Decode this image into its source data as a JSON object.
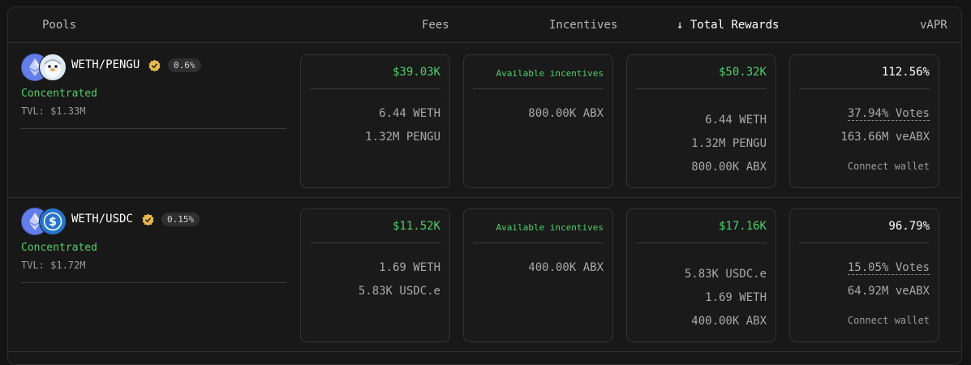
{
  "header": {
    "pools": "Pools",
    "fees": "Fees",
    "incentives": "Incentives",
    "sort_arrow": "↓",
    "total_rewards": "Total Rewards",
    "vapr": "vAPR"
  },
  "rows": [
    {
      "pair": "WETH/PENGU",
      "fee_tier": "0.6%",
      "type": "Concentrated",
      "tvl": "TVL: $1.33M",
      "fees": {
        "total": "$39.03K",
        "lines": [
          "6.44 WETH",
          "1.32M PENGU"
        ]
      },
      "incentives": {
        "label": "Available incentives",
        "lines": [
          "800.00K ABX"
        ]
      },
      "rewards": {
        "total": "$50.32K",
        "lines": [
          "6.44 WETH",
          "1.32M PENGU",
          "800.00K ABX"
        ]
      },
      "vapr": {
        "value": "112.56%",
        "votes": "37.94% Votes",
        "veabx": "163.66M veABX",
        "connect": "Connect wallet"
      }
    },
    {
      "pair": "WETH/USDC",
      "fee_tier": "0.15%",
      "type": "Concentrated",
      "tvl": "TVL: $1.72M",
      "fees": {
        "total": "$11.52K",
        "lines": [
          "1.69 WETH",
          "5.83K USDC.e"
        ]
      },
      "incentives": {
        "label": "Available incentives",
        "lines": [
          "400.00K ABX"
        ]
      },
      "rewards": {
        "total": "$17.16K",
        "lines": [
          "5.83K USDC.e",
          "1.69 WETH",
          "400.00K ABX"
        ]
      },
      "vapr": {
        "value": "96.79%",
        "votes": "15.05% Votes",
        "veabx": "64.92M veABX",
        "connect": "Connect wallet"
      }
    }
  ],
  "colors": {
    "accent_green": "#4ecf6a",
    "verified_gold": "#e8b84a",
    "eth": "#627eea",
    "usdc": "#2775ca"
  },
  "icons": [
    "eth-icon",
    "pengu-icon",
    "usdc-icon",
    "verified-badge-icon",
    "sort-arrow-icon"
  ]
}
